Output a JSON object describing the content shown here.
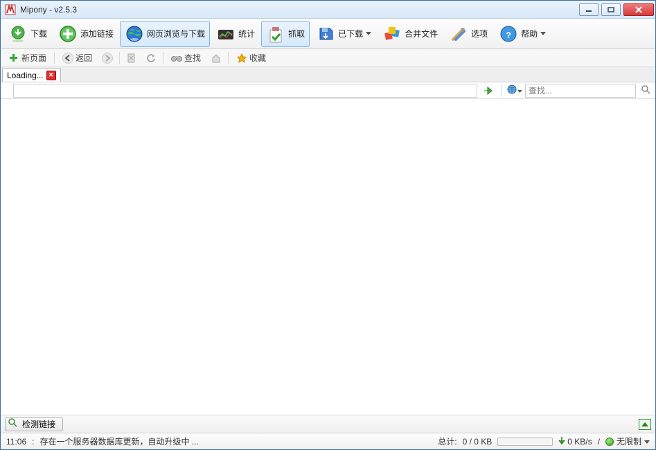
{
  "title": "Mipony - v2.5.3",
  "toolbar": {
    "download": "下载",
    "add_link": "添加链接",
    "browse_dl": "网页浏览与下载",
    "stats": "统计",
    "grab": "抓取",
    "downloaded": "已下载",
    "merge": "合并文件",
    "options": "选项",
    "help": "帮助"
  },
  "nav": {
    "new_page": "新页面",
    "back": "返回",
    "find": "查找",
    "favorites": "收藏"
  },
  "tab": {
    "label": "Loading..."
  },
  "search": {
    "placeholder": "查找..."
  },
  "detect": {
    "label": "检测链接"
  },
  "status": {
    "time": "11:06",
    "msg": "存在一个服务器数据库更新，自动升级中 ...",
    "totals_label": "总计:",
    "totals_value": "0 / 0 KB",
    "speed": "0 KB/s",
    "slash": "/",
    "limit": "无限制"
  }
}
